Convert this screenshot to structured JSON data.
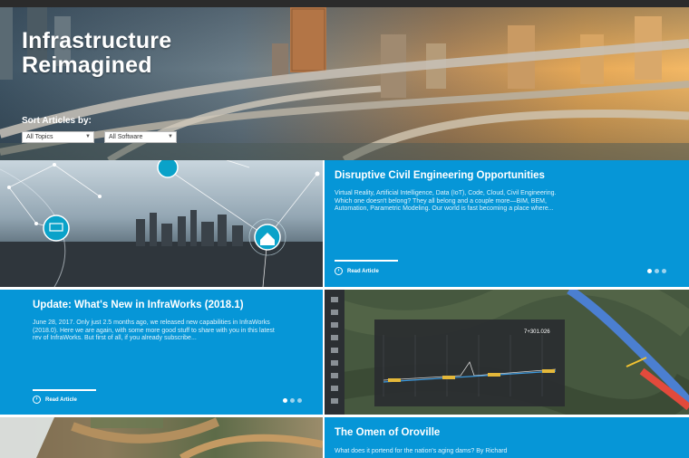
{
  "hero": {
    "title_line1": "Infrastructure",
    "title_line2": "Reimagined",
    "sort_label": "Sort Articles by:",
    "topics_select": "All Topics",
    "software_select": "All Software"
  },
  "articles": [
    {
      "title": "Disruptive Civil Engineering Opportunities",
      "excerpt": "Virtual Reality, Artificial Intelligence, Data (IoT), Code, Cloud, Civil Engineering. Which one doesn't belong? They all belong and a couple more—BIM, BEM, Automation, Parametric Modeling. Our world is fast becoming a place where...",
      "read_label": "Read Article"
    },
    {
      "title": "Update: What's New in InfraWorks (2018.1)",
      "excerpt": "June 28, 2017. Only just 2.5 months ago, we released new capabilities in InfraWorks (2018.0). Here we are again, with some more good stuff to share with you in this latest rev of InfraWorks. But first of all, if you already subscribe...",
      "read_label": "Read Article"
    },
    {
      "title": "The Omen of Oroville",
      "excerpt": "What does it portend for the nation's aging dams? By Richard"
    }
  ],
  "infraworks_readout": "7+301.026",
  "icons": {
    "arrow": "arrow-right-circle-icon",
    "chevron": "chevron-down-icon"
  },
  "colors": {
    "card_blue": "#0696d7",
    "topbar": "#2b2b2b"
  }
}
